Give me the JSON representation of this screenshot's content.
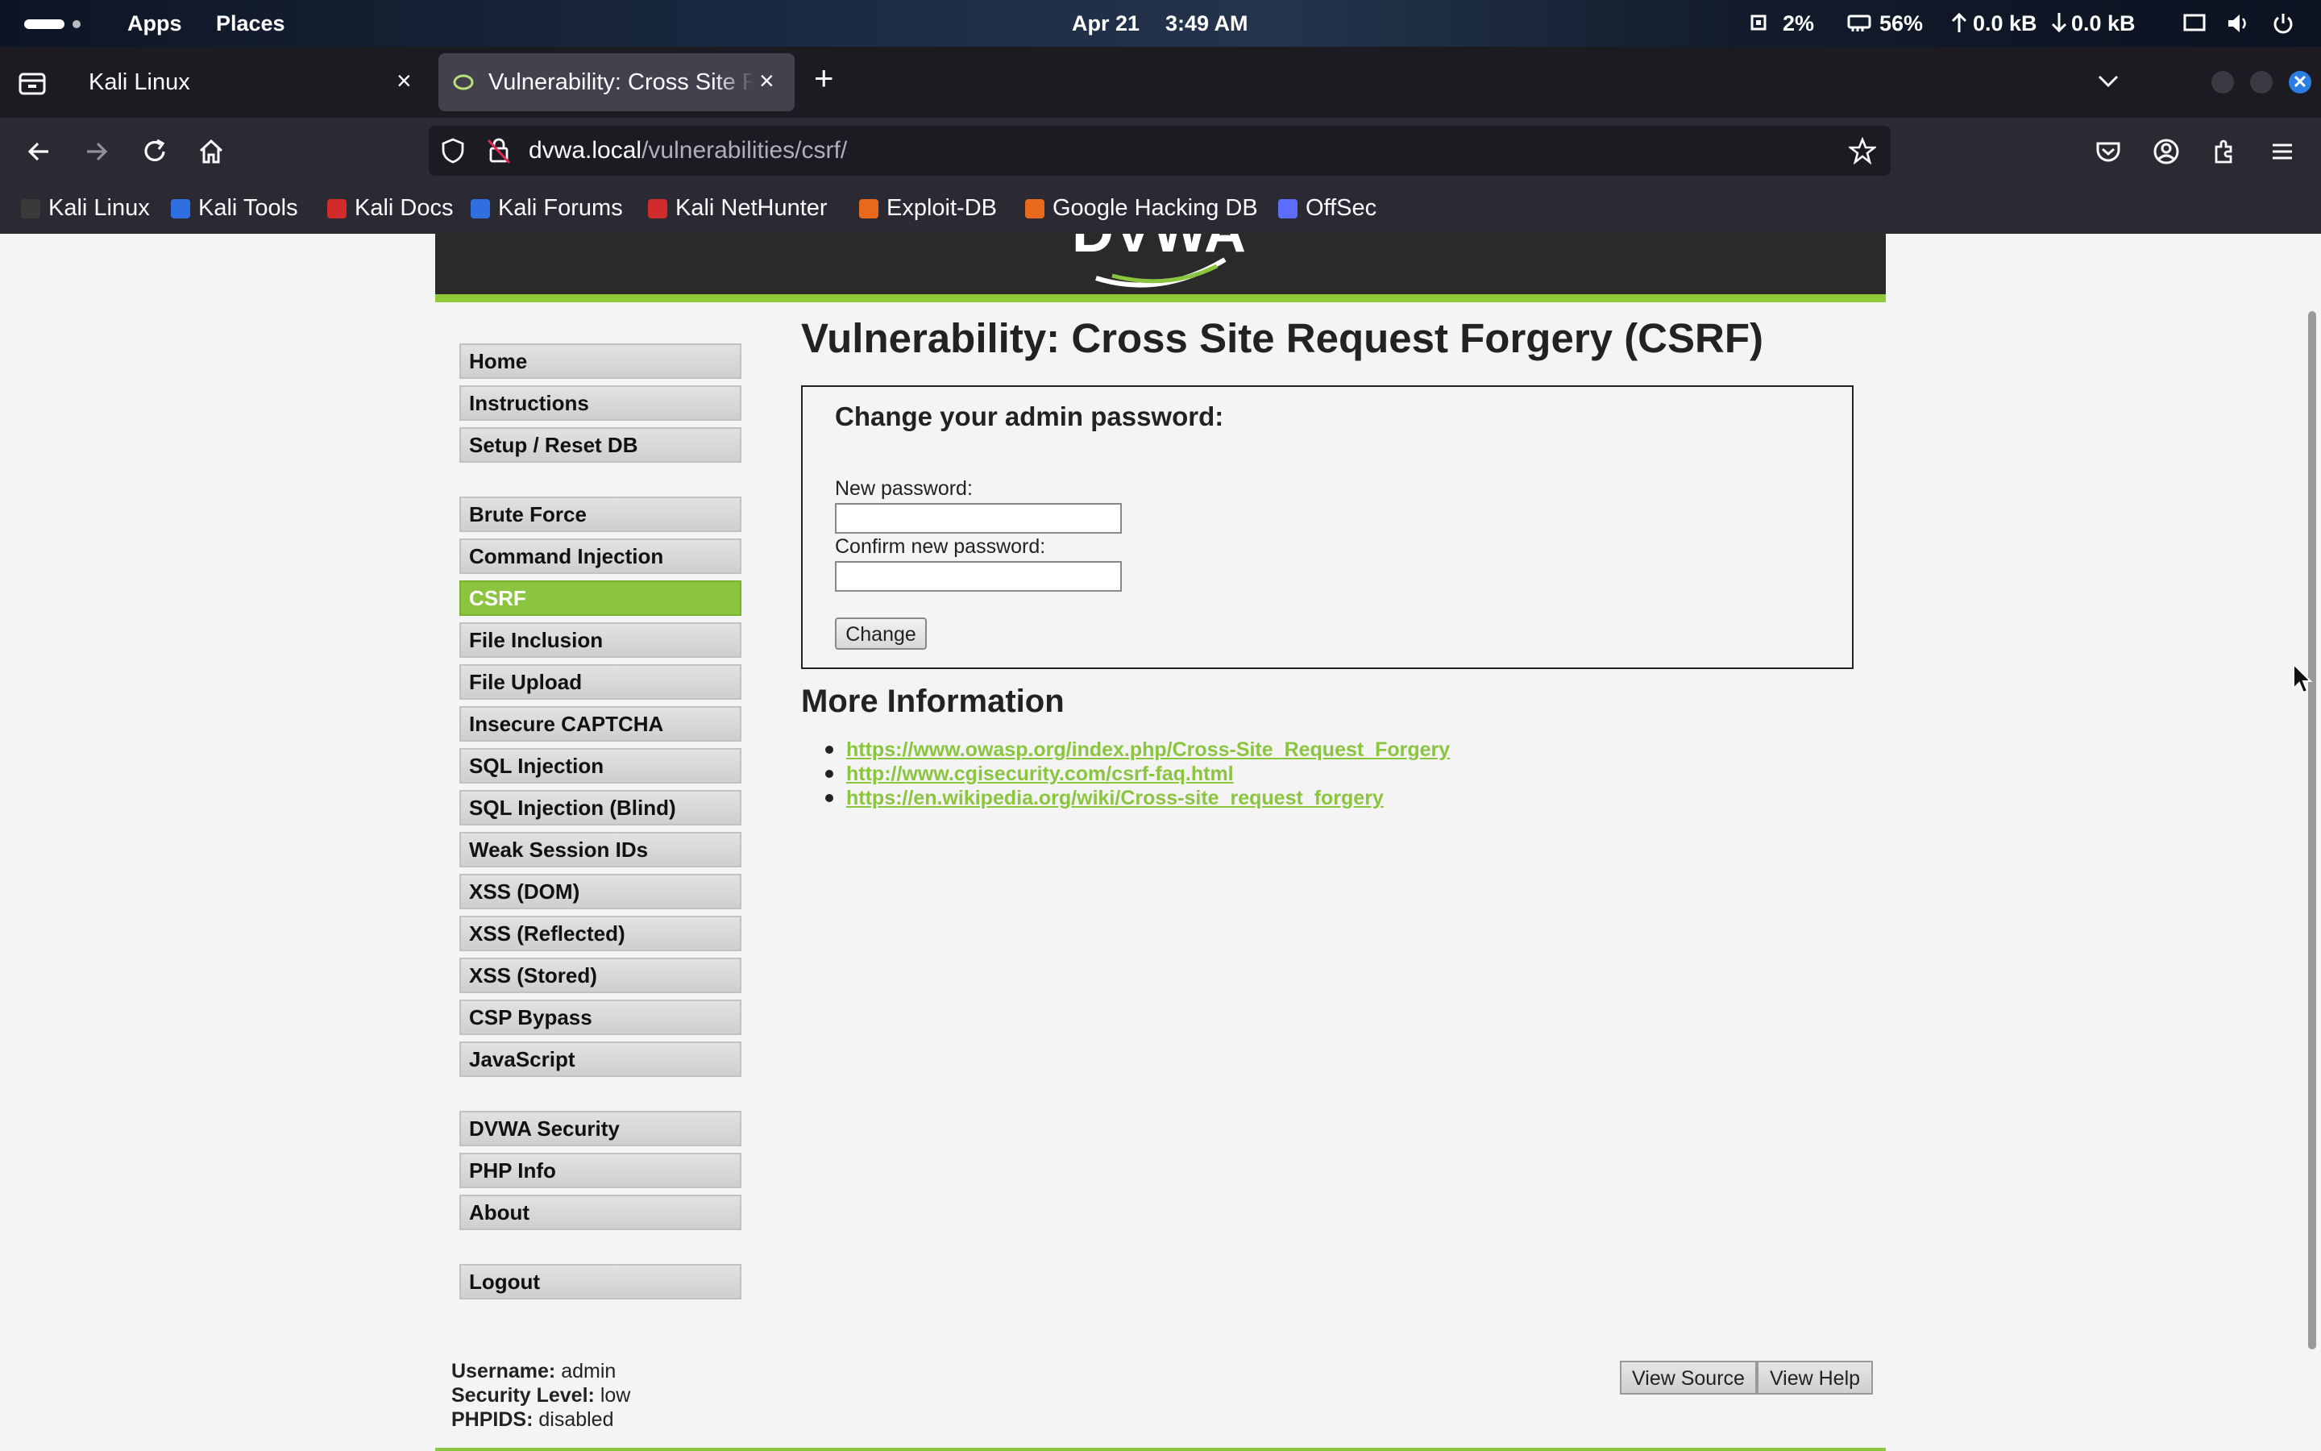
{
  "topbar": {
    "apps": "Apps",
    "places": "Places",
    "date": "Apr 21",
    "time": "3:49 AM",
    "cpu": "2%",
    "memory": "56%",
    "upload": "0.0 kB",
    "download": "0.0 kB"
  },
  "tabs": [
    {
      "title": "Kali Linux",
      "close": "×"
    },
    {
      "title": "Vulnerability: Cross Site Request Forgery (CSRF)",
      "close": "×"
    }
  ],
  "newtab": "+",
  "url": {
    "host": "dvwa.local",
    "path": "/vulnerabilities/csrf/"
  },
  "bookmarks": [
    {
      "label": "Kali Linux",
      "color": "#3a3a3a"
    },
    {
      "label": "Kali Tools",
      "color": "#2f6fe0"
    },
    {
      "label": "Kali Docs",
      "color": "#d22b2b"
    },
    {
      "label": "Kali Forums",
      "color": "#2f6fe0"
    },
    {
      "label": "Kali NetHunter",
      "color": "#d22b2b"
    },
    {
      "label": "Exploit-DB",
      "color": "#e8691c"
    },
    {
      "label": "Google Hacking DB",
      "color": "#e8691c"
    },
    {
      "label": "OffSec",
      "color": "#5b6cff"
    }
  ],
  "menu": {
    "group1": [
      "Home",
      "Instructions",
      "Setup / Reset DB"
    ],
    "group2": [
      "Brute Force",
      "Command Injection",
      "CSRF",
      "File Inclusion",
      "File Upload",
      "Insecure CAPTCHA",
      "SQL Injection",
      "SQL Injection (Blind)",
      "Weak Session IDs",
      "XSS (DOM)",
      "XSS (Reflected)",
      "XSS (Stored)",
      "CSP Bypass",
      "JavaScript"
    ],
    "group3": [
      "DVWA Security",
      "PHP Info",
      "About"
    ],
    "group4": [
      "Logout"
    ],
    "active": "CSRF"
  },
  "page": {
    "title": "Vulnerability: Cross Site Request Forgery (CSRF)",
    "form_title": "Change your admin password:",
    "new_password_label": "New password:",
    "confirm_password_label": "Confirm new password:",
    "change_button": "Change",
    "more_info": "More Information",
    "links": [
      "https://www.owasp.org/index.php/Cross-Site_Request_Forgery",
      "http://www.cgisecurity.com/csrf-faq.html",
      "https://en.wikipedia.org/wiki/Cross-site_request_forgery"
    ]
  },
  "footer": {
    "username_label": "Username:",
    "username": "admin",
    "security_label": "Security Level:",
    "security": "low",
    "phpids_label": "PHPIDS:",
    "phpids": "disabled",
    "view_source": "View Source",
    "view_help": "View Help"
  },
  "colors": {
    "accent": "#8bc53f",
    "header": "#2a2a2a"
  }
}
